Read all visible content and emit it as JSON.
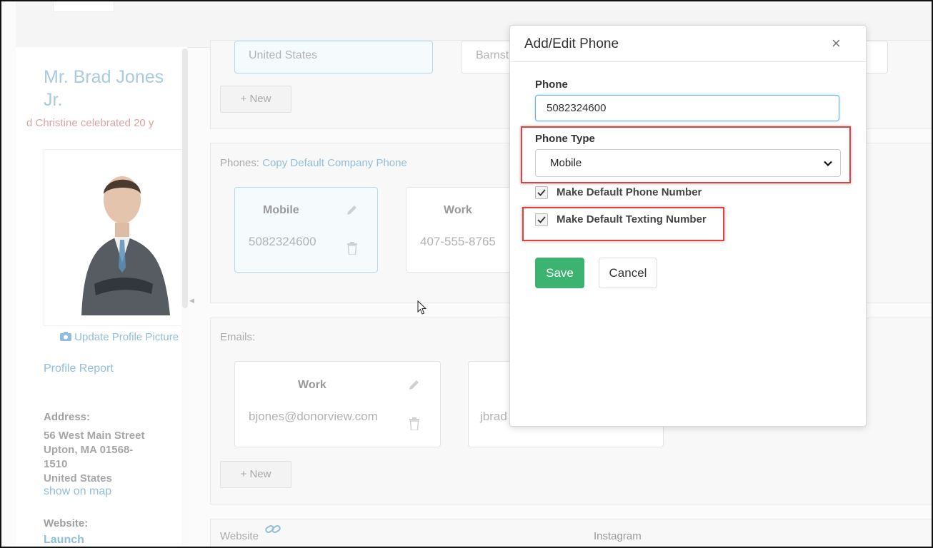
{
  "sidebar": {
    "name": "Mr. Brad Jones Jr.",
    "marquee": "d Christine celebrated 20 y",
    "update_picture": "Update Profile Picture",
    "profile_report": "Profile Report",
    "address_label": "Address:",
    "address_line1": "56 West Main Street",
    "address_line2": "Upton, MA 01568-",
    "address_line3": "1510",
    "address_line4": "United States",
    "show_on_map": "show on map",
    "website_label": "Website:",
    "website_launch": "Launch"
  },
  "address_section": {
    "country": "United States",
    "city_partial": "Barnsta",
    "new_button": "+ New"
  },
  "phones": {
    "label": "Phones:",
    "copy_link": "Copy Default Company Phone",
    "cards": [
      {
        "type": "Mobile",
        "number": "5082324600"
      },
      {
        "type": "Work",
        "number": "407-555-8765"
      }
    ]
  },
  "emails": {
    "label": "Emails:",
    "cards": [
      {
        "type": "Work",
        "address": "bjones@donorview.com"
      },
      {
        "type": "",
        "address": "jbrad"
      }
    ],
    "new_button": "+ New"
  },
  "social": {
    "website_label": "Website",
    "instagram_label": "Instagram"
  },
  "modal": {
    "title": "Add/Edit Phone",
    "close": "×",
    "phone_label": "Phone",
    "phone_value": "5082324600",
    "phone_type_label": "Phone Type",
    "phone_type_value": "Mobile",
    "default_phone_label": "Make Default Phone Number",
    "default_texting_label": "Make Default Texting Number",
    "save_label": "Save",
    "cancel_label": "Cancel"
  },
  "colors": {
    "accent": "#3cb371",
    "highlight": "#e04040",
    "link": "#8fbfdd"
  }
}
